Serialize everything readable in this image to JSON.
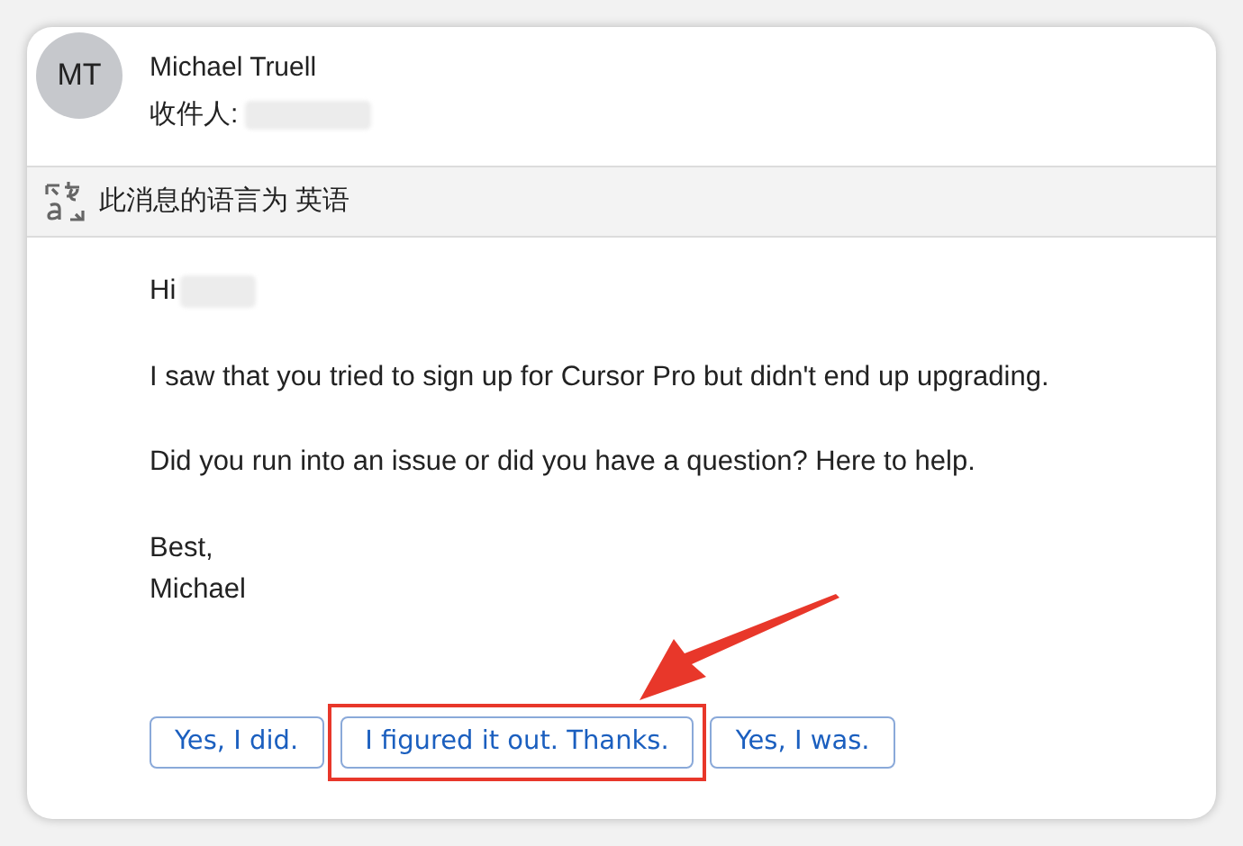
{
  "sender": {
    "initials": "MT",
    "name": "Michael Truell"
  },
  "recipient_label": "收件人:",
  "language_bar": {
    "text": "此消息的语言为 英语"
  },
  "body": {
    "greeting": "Hi",
    "paragraphs": [
      "I saw that you tried to sign up for Cursor Pro but didn't end up upgrading.",
      "Did you run into an issue or did you have a question? Here to help."
    ],
    "signoff": [
      "Best,",
      "Michael"
    ]
  },
  "quick_replies": [
    {
      "label": "Yes, I did.",
      "highlighted": false
    },
    {
      "label": "I figured it out. Thanks.",
      "highlighted": true
    },
    {
      "label": "Yes, I was.",
      "highlighted": false
    }
  ]
}
